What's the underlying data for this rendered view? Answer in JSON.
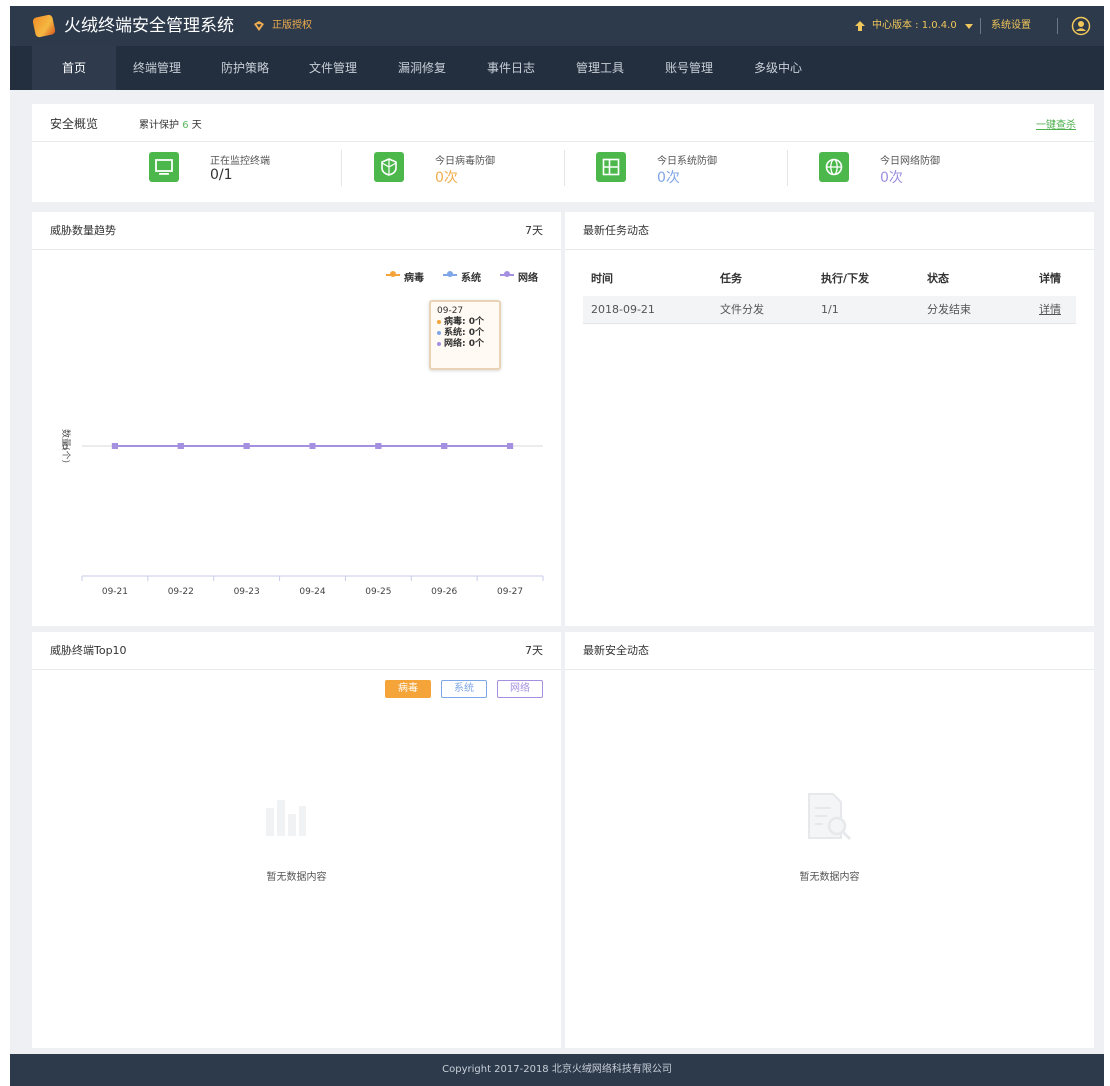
{
  "header": {
    "title": "火绒终端安全管理系统",
    "license": "正版授权",
    "version": "中心版本 : 1.0.4.0",
    "settings": "系统设置",
    "icons": {
      "logo": "huorong-logo-icon",
      "license": "badge-icon",
      "version": "upgrade-arrow-icon",
      "user": "user-avatar-icon"
    }
  },
  "nav": {
    "items": [
      {
        "label": "首页",
        "active": true
      },
      {
        "label": "终端管理"
      },
      {
        "label": "防护策略"
      },
      {
        "label": "文件管理"
      },
      {
        "label": "漏洞修复"
      },
      {
        "label": "事件日志"
      },
      {
        "label": "管理工具"
      },
      {
        "label": "账号管理"
      },
      {
        "label": "多级中心"
      }
    ]
  },
  "overview": {
    "title": "安全概览",
    "protect_prefix": "累计保护",
    "protect_days": "6",
    "protect_unit": "天",
    "scan_link": "一键查杀",
    "stats": [
      {
        "label": "正在监控终端",
        "value": "0/1",
        "icon": "monitor-icon",
        "color": "#333333"
      },
      {
        "label": "今日病毒防御",
        "value": "0次",
        "icon": "shield-icon",
        "color": "#f0ad4e"
      },
      {
        "label": "今日系统防御",
        "value": "0次",
        "icon": "windows-icon",
        "color": "#7fa6e6"
      },
      {
        "label": "今日网络防御",
        "value": "0次",
        "icon": "globe-icon",
        "color": "#9b8fe0"
      }
    ]
  },
  "threat_trend": {
    "title": "威胁数量趋势",
    "range": "7天",
    "legend": [
      "病毒",
      "系统",
      "网络"
    ],
    "colors": {
      "virus": "#f5a43a",
      "system": "#7fa6e6",
      "network": "#a58fe0"
    },
    "tooltip": {
      "date": "09-27",
      "rows": [
        "病毒: 0个",
        "系统: 0个",
        "网络: 0个"
      ]
    }
  },
  "chart_data": {
    "type": "line",
    "categories": [
      "09-21",
      "09-22",
      "09-23",
      "09-24",
      "09-25",
      "09-26",
      "09-27"
    ],
    "series": [
      {
        "name": "病毒",
        "values": [
          0,
          0,
          0,
          0,
          0,
          0,
          0
        ],
        "color": "#f5a43a"
      },
      {
        "name": "系统",
        "values": [
          0,
          0,
          0,
          0,
          0,
          0,
          0
        ],
        "color": "#7fa6e6"
      },
      {
        "name": "网络",
        "values": [
          0,
          0,
          0,
          0,
          0,
          0,
          0
        ],
        "color": "#a58fe0"
      }
    ],
    "ylabel": "数量(个)",
    "yticks": [
      "0"
    ],
    "grid": false,
    "legend": "top-right"
  },
  "tasks": {
    "title": "最新任务动态",
    "headers": [
      "时间",
      "任务",
      "执行/下发",
      "状态",
      "详情"
    ],
    "rows": [
      [
        "2018-09-21",
        "文件分发",
        "1/1",
        "分发结束",
        "详情"
      ]
    ]
  },
  "top10": {
    "title": "威胁终端Top10",
    "range": "7天",
    "filters": [
      "病毒",
      "系统",
      "网络"
    ],
    "empty": "暂无数据内容"
  },
  "security": {
    "title": "最新安全动态",
    "empty": "暂无数据内容"
  },
  "footer": {
    "text": "Copyright 2017-2018 北京火绒网络科技有限公司"
  }
}
